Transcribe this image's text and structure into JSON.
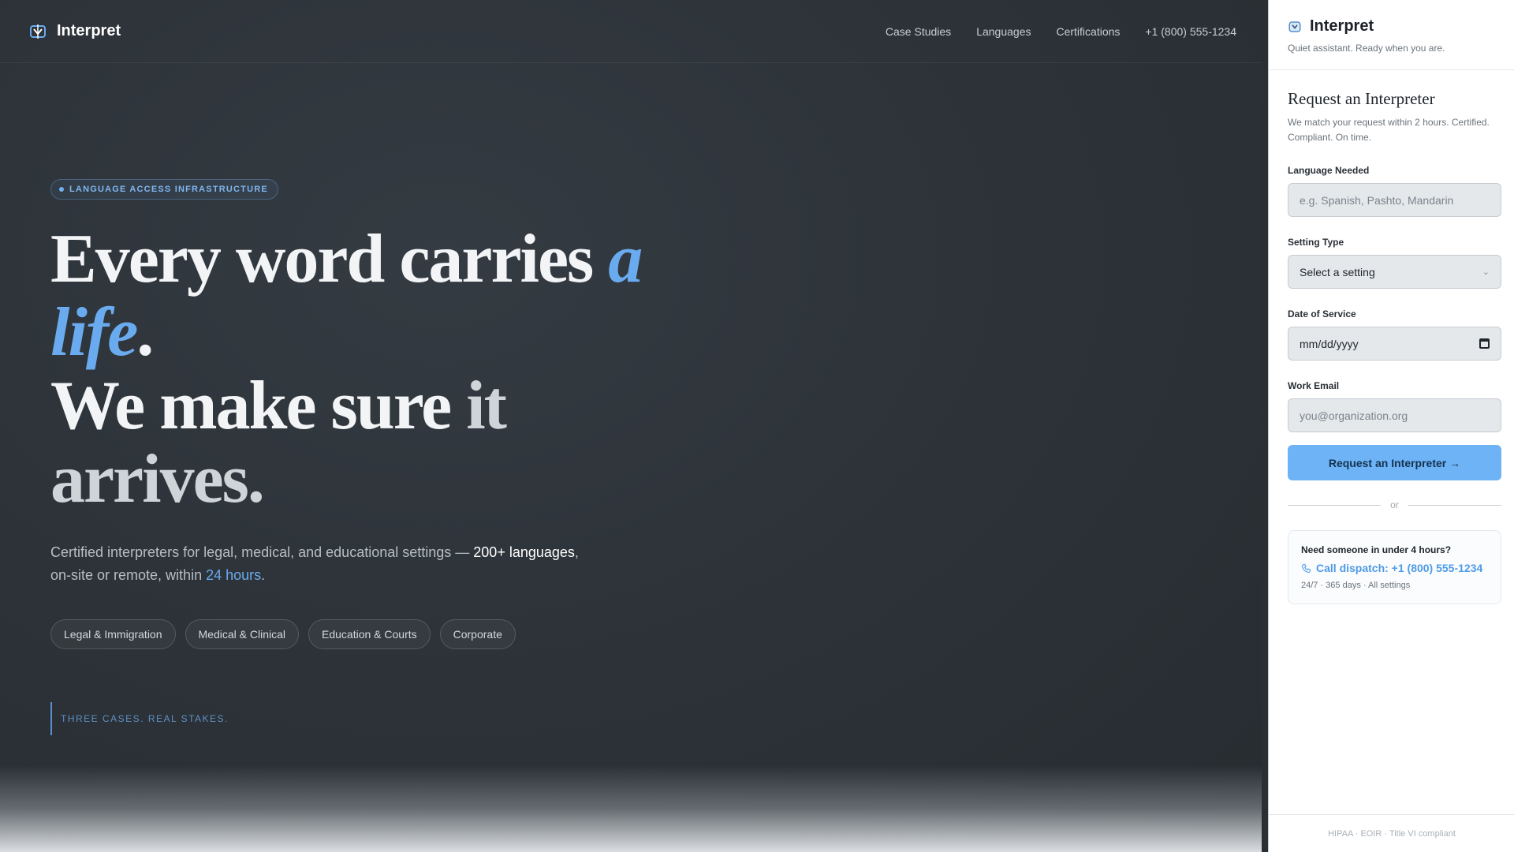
{
  "nav": {
    "brand": "Interpret",
    "links": [
      "Case Studies",
      "Languages",
      "Certifications",
      "+1 (800) 555-1234"
    ]
  },
  "hero": {
    "eyebrow": "LANGUAGE ACCESS INFRASTRUCTURE",
    "headline": {
      "part1": "Every word carries ",
      "accent": "a life",
      "period1": ".",
      "part2": "We make sure ",
      "muted": "it arrives",
      "period2": "."
    },
    "sub": {
      "text1": "Certified interpreters for legal, medical, and educational settings — ",
      "strong": "200+ languages",
      "text2": ", on-site or remote, within ",
      "link": "24 hours",
      "text3": "."
    },
    "tags": [
      "Legal & Immigration",
      "Medical & Clinical",
      "Education & Courts",
      "Corporate"
    ],
    "cases_label": "THREE CASES. REAL STAKES."
  },
  "panel": {
    "brand": "Interpret",
    "tagline": "Quiet assistant. Ready when you are.",
    "form": {
      "title": "Request an Interpreter",
      "description": "We match your request within 2 hours. Certified. Compliant. On time.",
      "language_label": "Language Needed",
      "language_placeholder": "e.g. Spanish, Pashto, Mandarin",
      "setting_label": "Setting Type",
      "setting_value": "Select a setting",
      "date_label": "Date of Service",
      "date_placeholder": "mm/dd/yyyy",
      "email_label": "Work Email",
      "email_placeholder": "you@organization.org",
      "submit_label": "Request an Interpreter →",
      "divider": "or"
    },
    "dispatch": {
      "question": "Need someone in under 4 hours?",
      "call": "Call dispatch: +1 (800) 555-1234",
      "meta": "24/7 · 365 days · All settings"
    },
    "footer": "HIPAA · EOIR · Title VI compliant"
  },
  "colors": {
    "accent": "#6aabef",
    "hero_bg": "#2d3339",
    "button": "#6db3f5"
  }
}
